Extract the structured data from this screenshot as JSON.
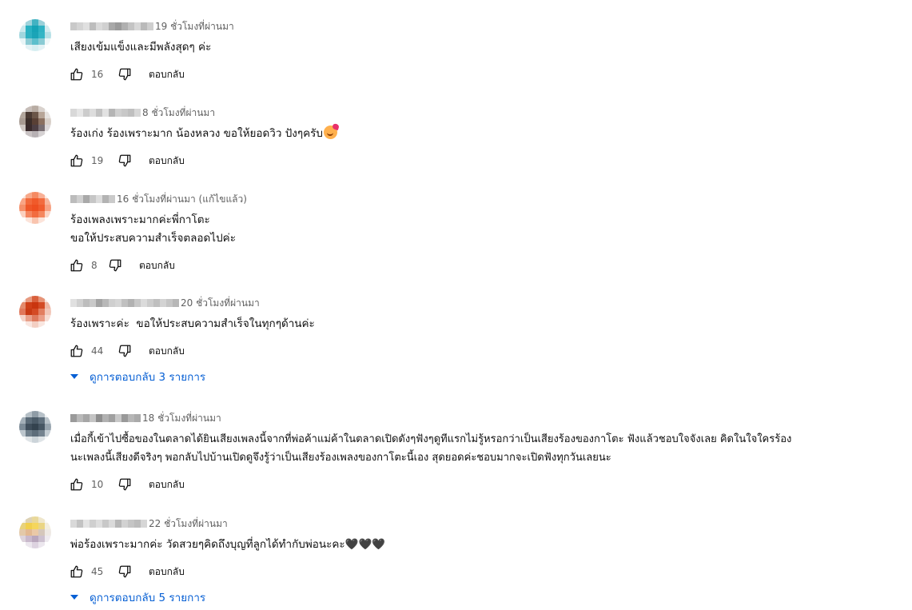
{
  "comments": [
    {
      "time": "19 ชั่วโมงที่ผ่านมา",
      "text": "เสียงเข้มแข็งและมีพลังสุดๆ ค่ะ",
      "likes": "16",
      "reply_label": "ตอบกลับ",
      "avatar_colors": [
        "#e9f4f6",
        "#9fd3dc",
        "#42b2c2",
        "#9ad0d9",
        "#eef7f8",
        "#c9e8ed",
        "#2ab1c2",
        "#16a3b6",
        "#2fb2c3",
        "#d2ecf0",
        "#9fd6de",
        "#2cb0c1",
        "#1ba4b7",
        "#33b5c5",
        "#b5e0e6",
        "#e8f5f7",
        "#8ccbd4",
        "#5cbfcc",
        "#8acbd4",
        "#eef7f8",
        "#ffffff",
        "#e3f2f5",
        "#d6eef1",
        "#e3f2f5",
        "#ffffff"
      ],
      "author_blur": [
        "#c9c9c9",
        "#d4d4d4",
        "#e0e0e0",
        "#bdbdbd",
        "#dadada",
        "#d0d0d0",
        "#a8a8a8",
        "#9a9a9a",
        "#b0b0b0",
        "#c4c4c4",
        "#d8d8d8",
        "#bababa",
        "#cfcfcf"
      ]
    },
    {
      "time": "8 ชั่วโมงที่ผ่านมา",
      "text": "ร้องเก่ง ร้องเพราะมาก น้องหลวง ขอให้ยอดวิว ปังๆครับ",
      "has_emoji": true,
      "likes": "19",
      "reply_label": "ตอบกลับ",
      "avatar_colors": [
        "#f1efee",
        "#c6bdb8",
        "#b8aca3",
        "#d9d2cd",
        "#f4f3f2",
        "#b2a69c",
        "#4a3a33",
        "#6b5649",
        "#b7a597",
        "#e6e2df",
        "#a89b92",
        "#3c2e2a",
        "#594035",
        "#8a7060",
        "#d8cfc8",
        "#cfc7c2",
        "#3a2b2c",
        "#4d3f44",
        "#786e72",
        "#dcd8d9",
        "#f3f1f0",
        "#c9c3c4",
        "#b7b1b4",
        "#d6d2d3",
        "#f7f6f6"
      ],
      "author_blur": [
        "#d8d8d8",
        "#e6e6e6",
        "#cccccc",
        "#dddddd",
        "#c2c2c2",
        "#e2e2e2",
        "#b5b5b5",
        "#d0d0d0",
        "#c8c8c8",
        "#bfbfbf",
        "#d7d7d7"
      ]
    },
    {
      "time": "16 ชั่วโมงที่ผ่านมา (แก้ไขแล้ว)",
      "text": "ร้องเพลงเพราะมากค่ะพี่กาโตะ\nขอให้ประสบความสำเร็จตลอดไปค่ะ",
      "likes": "8",
      "reply_label": "ตอบกลับ",
      "avatar_colors": [
        "#fbe3d9",
        "#f7a98a",
        "#f58a62",
        "#f8b096",
        "#fde9e1",
        "#f9a585",
        "#f26a3c",
        "#f05a2a",
        "#f26b3e",
        "#f8b59b",
        "#f58f69",
        "#ef5728",
        "#ee4f20",
        "#f05d2f",
        "#f7a182",
        "#fbd0bf",
        "#f48660",
        "#f26c40",
        "#f4875f",
        "#fbd4c4",
        "#ffffff",
        "#fce4da",
        "#f9c4ae",
        "#fce4da",
        "#ffffff"
      ],
      "author_blur": [
        "#bcbcbc",
        "#cfcfcf",
        "#a9a9a9",
        "#c6c6c6",
        "#dcdcdc",
        "#b3b3b3",
        "#cacaca"
      ]
    },
    {
      "time": "20 ชั่วโมงที่ผ่านมา",
      "text": "ร้องเพราะค่ะ  ขอให้ประสบความสำเร็จในทุกๆด้านค่ะ",
      "likes": "44",
      "reply_label": "ตอบกลับ",
      "replies_label": "ดูการตอบกลับ 3 รายการ",
      "avatar_colors": [
        "#f6dcd3",
        "#e79a80",
        "#d9603c",
        "#e69478",
        "#f8e2da",
        "#e38a6c",
        "#cf3f18",
        "#c9350f",
        "#d34b25",
        "#eeb7a4",
        "#e0775a",
        "#c83a14",
        "#d44a24",
        "#e27e60",
        "#f2c6b8",
        "#f4d3c8",
        "#e8a08a",
        "#de7a5e",
        "#ea9e88",
        "#f7ddd4",
        "#ffffff",
        "#f9e6e0",
        "#f3cfc3",
        "#f9e6e0",
        "#ffffff"
      ],
      "author_blur": [
        "#e0e0e0",
        "#d0d0d0",
        "#bdbdbd",
        "#c9c9c9",
        "#a3a3a3",
        "#b8b8b8",
        "#cfcfcf",
        "#d6d6d6",
        "#c0c0c0",
        "#b1b1b1",
        "#c7c7c7",
        "#dbdbdb",
        "#cccccc",
        "#bfbfbf",
        "#d3d3d3",
        "#c5c5c5",
        "#b7b7b7"
      ]
    },
    {
      "time": "18 ชั่วโมงที่ผ่านมา",
      "text": "เมื่อกี้เข้าไปซื้อของในตลาดได้ยินเสียงเพลงนี้จากที่พ่อค้าแม่ค้าในตลาดเปิดดังๆฟังๆดูทีแรกไม่รู้หรอกว่าเป็นเสียงร้องของกาโตะ ฟังแล้วชอบใจจังเลย คิดในใจใครร้อง\nนะเพลงนี้เสียงดีจริงๆ พอกลับไปบ้านเปิดดูจึงรู้ว่าเป็นเสียงร้องเพลงของกาโตะนี้เอง สุดยอดค่ะชอบมากจะเปิดฟังทุกวันเลยนะ",
      "likes": "10",
      "reply_label": "ตอบกลับ",
      "avatar_colors": [
        "#eceff1",
        "#b5bfc6",
        "#8f9ca6",
        "#b7c1c8",
        "#eef1f3",
        "#a3afb8",
        "#5a6a77",
        "#4b5b68",
        "#5f6f7c",
        "#b9c3ca",
        "#7b8a96",
        "#3f4e5b",
        "#34434f",
        "#465663",
        "#97a4ae",
        "#bcc6cd",
        "#6f7f8b",
        "#5d6d7a",
        "#74838f",
        "#c4cdd3",
        "#f5f7f8",
        "#dfe4e7",
        "#ccd4d9",
        "#dfe4e7",
        "#f5f7f8"
      ],
      "author_blur": [
        "#9a9a9a",
        "#b9b9b9",
        "#a6a6a6",
        "#c4c4c4",
        "#8e8e8e",
        "#b1b1b1",
        "#a0a0a0",
        "#c8c8c8",
        "#999999",
        "#b6b6b6",
        "#aaaaaa"
      ]
    },
    {
      "time": "22 ชั่วโมงที่ผ่านมา",
      "text": "พ่อร้องเพราะมากค่ะ วัดสวยๆคิดถึงบุญที่ลูกได้ทำกับพ่อนะคะ🖤🖤🖤",
      "likes": "45",
      "reply_label": "ตอบกลับ",
      "replies_label": "ดูการตอบกลับ 5 รายการ",
      "avatar_colors": [
        "#f5f2ea",
        "#ddd2b4",
        "#e9d89a",
        "#efe7cc",
        "#faf9f6",
        "#e8d27c",
        "#f1cf4d",
        "#f5d65c",
        "#ead584",
        "#f3eedf",
        "#e3c9a9",
        "#e2b992",
        "#eac9a7",
        "#d5c7bb",
        "#eee9e4",
        "#ddd4dc",
        "#c9b9cc",
        "#b9a7bd",
        "#cdc1d0",
        "#efebf0",
        "#ffffff",
        "#ece7ee",
        "#ddd3e0",
        "#ece7ee",
        "#ffffff"
      ],
      "author_blur": [
        "#d9d9d9",
        "#c3c3c3",
        "#e4e4e4",
        "#cfcfcf",
        "#dedede",
        "#c8c8c8",
        "#dadada",
        "#b7b7b7",
        "#d2d2d2",
        "#c5c5c5",
        "#bcbcbc",
        "#d6d6d6"
      ]
    }
  ]
}
